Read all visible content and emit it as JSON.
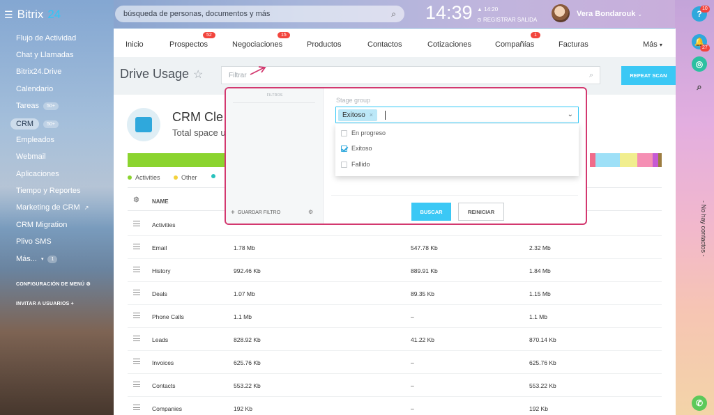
{
  "app": {
    "name_word": "Bitrix",
    "name_num": "24"
  },
  "header": {
    "search_placeholder": "búsqueda de personas, documentos y más",
    "clock": "14:39",
    "clock_sub_time": "14:20",
    "clock_sub_action": "REGISTRAR SALIDA",
    "user_name": "Vera Bondarouk"
  },
  "right_rail": {
    "help_badge": "10",
    "notif_badge": "27",
    "vertical_text": "- No hay contactos -"
  },
  "sidebar": {
    "items": [
      {
        "label": "Flujo de Actividad"
      },
      {
        "label": "Chat y Llamadas"
      },
      {
        "label": "Bitrix24.Drive"
      },
      {
        "label": "Calendario"
      },
      {
        "label": "Tareas",
        "count": "50+"
      },
      {
        "label": "CRM",
        "count": "50+",
        "active": true
      },
      {
        "label": "Empleados"
      },
      {
        "label": "Webmail"
      },
      {
        "label": "Aplicaciones"
      },
      {
        "label": "Tiempo y Reportes"
      },
      {
        "label": "Marketing de CRM"
      },
      {
        "label": "CRM Migration"
      },
      {
        "label": "Plivo SMS"
      },
      {
        "label": "Más...",
        "count": "1"
      }
    ],
    "config_menu": "CONFIGURACIÓN DE MENÚ",
    "invite_users": "INVITAR A USUARIOS"
  },
  "topnav": {
    "tabs": [
      {
        "label": "Inicio"
      },
      {
        "label": "Prospectos",
        "badge": "52"
      },
      {
        "label": "Negociaciones",
        "badge": "15"
      },
      {
        "label": "Productos"
      },
      {
        "label": "Contactos"
      },
      {
        "label": "Cotizaciones"
      },
      {
        "label": "Compañías",
        "badge": "1"
      },
      {
        "label": "Facturas"
      },
      {
        "label": "Más"
      }
    ]
  },
  "page": {
    "title": "Drive Usage",
    "filter_placeholder": "Filtrar",
    "repeat_scan": "REPEAT SCAN",
    "crm_title": "CRM Cle",
    "crm_subtitle": "Total space u",
    "legend": [
      {
        "label": "Activities",
        "color": "#8bd42f"
      },
      {
        "label": "Other",
        "color": "#f4d23b"
      }
    ],
    "table": {
      "header_name": "NAME",
      "rows": [
        {
          "name": "Activities",
          "c1": "",
          "c2": "",
          "c3": ""
        },
        {
          "name": "Email",
          "c1": "1.78 Mb",
          "c2": "547.78 Kb",
          "c3": "2.32 Mb"
        },
        {
          "name": "History",
          "c1": "992.46 Kb",
          "c2": "889.91 Kb",
          "c3": "1.84 Mb"
        },
        {
          "name": "Deals",
          "c1": "1.07 Mb",
          "c2": "89.35 Kb",
          "c3": "1.15 Mb"
        },
        {
          "name": "Phone Calls",
          "c1": "1.1 Mb",
          "c2": "–",
          "c3": "1.1 Mb"
        },
        {
          "name": "Leads",
          "c1": "828.92 Kb",
          "c2": "41.22 Kb",
          "c3": "870.14 Kb"
        },
        {
          "name": "Invoices",
          "c1": "625.76 Kb",
          "c2": "–",
          "c3": "625.76 Kb"
        },
        {
          "name": "Contacts",
          "c1": "553.22 Kb",
          "c2": "–",
          "c3": "553.22 Kb"
        },
        {
          "name": "Companies",
          "c1": "192 Kb",
          "c2": "–",
          "c3": "192 Kb"
        }
      ]
    }
  },
  "filter_popup": {
    "filters_header": "FILTROS",
    "save_filter": "GUARDAR FILTRO",
    "stage_group_label": "Stage group",
    "selected_tag": "Exitoso",
    "options": [
      {
        "label": "En progreso",
        "checked": false
      },
      {
        "label": "Exitoso",
        "checked": true
      },
      {
        "label": "Fallido",
        "checked": false
      }
    ],
    "search_button": "BUSCAR",
    "reset_button": "REINICIAR"
  }
}
